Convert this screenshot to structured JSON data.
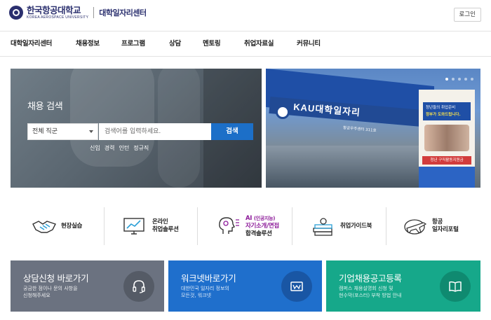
{
  "header": {
    "logo_kor": "한국항공대학교",
    "logo_eng": "KOREA AEROSPACE UNIVERSITY",
    "center_name": "대학일자리센터",
    "login_label": "로그인"
  },
  "nav": {
    "items": [
      {
        "label": "대학일자리센터"
      },
      {
        "label": "채용정보"
      },
      {
        "label": "프로그램"
      },
      {
        "label": "상담"
      },
      {
        "label": "멘토링"
      },
      {
        "label": "취업자료실"
      },
      {
        "label": "커뮤니티"
      }
    ]
  },
  "search": {
    "title": "채용 검색",
    "select_value": "전체 직군",
    "input_placeholder": "검색어를 입력하세요.",
    "button_label": "검색",
    "tags": [
      "신입",
      "경력",
      "인턴",
      "정규직"
    ]
  },
  "photo_banner": {
    "tent_text": "KAU대학일자리",
    "tent_sub": "항공우주센터 311호",
    "poster_line1": "청년들의 취업준비",
    "poster_line2": "정부가 도와드립니다.",
    "poster_bottom": "청년 구직활동지원금",
    "slide_count": 5,
    "active_slide": 1
  },
  "quick_menu": [
    {
      "icon": "handshake-icon",
      "label": "현장실습"
    },
    {
      "icon": "monitor-chart-icon",
      "label_line1": "온라인",
      "label_line2": "취업솔루션"
    },
    {
      "icon": "ai-head-icon",
      "label_ai": "AI",
      "label_ai_sub": "(인공지능)",
      "label_line2": "자기소개/면접",
      "label_line3": "합격솔루션"
    },
    {
      "icon": "books-icon",
      "label": "취업가이드북"
    },
    {
      "icon": "airplane-globe-icon",
      "label_line1": "항공",
      "label_line2": "일자리포털"
    }
  ],
  "cards": [
    {
      "title": "상담신청 바로가기",
      "desc_line1": "궁금한 점이나 문의 사항을",
      "desc_line2": "신청해주세요",
      "icon": "headset-icon"
    },
    {
      "title": "워크넷바로가기",
      "desc_line1": "대한민국 일자리 정보의",
      "desc_line2": "모든것, 워크넷",
      "icon": "worknet-icon"
    },
    {
      "title": "기업채용공고등록",
      "desc_line1": "캠퍼스 채용설명회 신청 및",
      "desc_line2": "현수막(포스터) 부착 방법 안내",
      "icon": "book-icon"
    }
  ],
  "colors": {
    "brand_navy": "#2a2f6e",
    "search_blue": "#1c6fc8",
    "card_gray": "#6b7280",
    "card_blue": "#1f6fcc",
    "card_green": "#16a88a",
    "ai_purple": "#8d1c9a"
  }
}
